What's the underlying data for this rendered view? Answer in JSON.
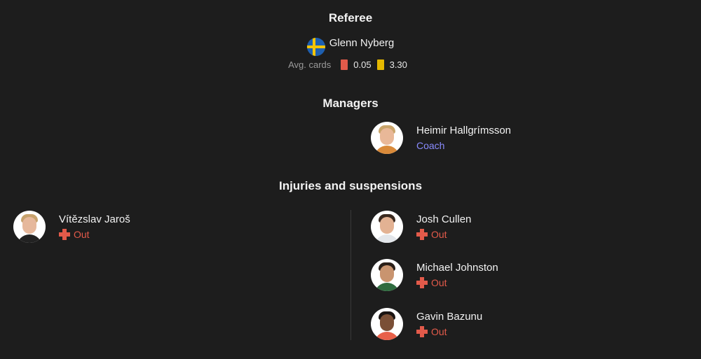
{
  "referee": {
    "title": "Referee",
    "name": "Glenn Nyberg",
    "flag_icon": "sweden-flag-icon",
    "avg_cards_label": "Avg. cards",
    "red_cards": "0.05",
    "yellow_cards": "3.30"
  },
  "managers": {
    "title": "Managers",
    "items": [
      {
        "name": "Heimir Hallgrímsson",
        "role": "Coach"
      }
    ]
  },
  "injuries": {
    "title": "Injuries and suspensions",
    "home": [
      {
        "name": "Vítězslav Jaroš",
        "status": "Out"
      }
    ],
    "away": [
      {
        "name": "Josh Cullen",
        "status": "Out"
      },
      {
        "name": "Michael Johnston",
        "status": "Out"
      },
      {
        "name": "Gavin Bazunu",
        "status": "Out"
      }
    ]
  },
  "colors": {
    "background": "#1d1d1d",
    "red_card": "#e25a4a",
    "yellow_card": "#e5b800",
    "coach_role": "#8a8cff",
    "out_status": "#e25a4a"
  }
}
